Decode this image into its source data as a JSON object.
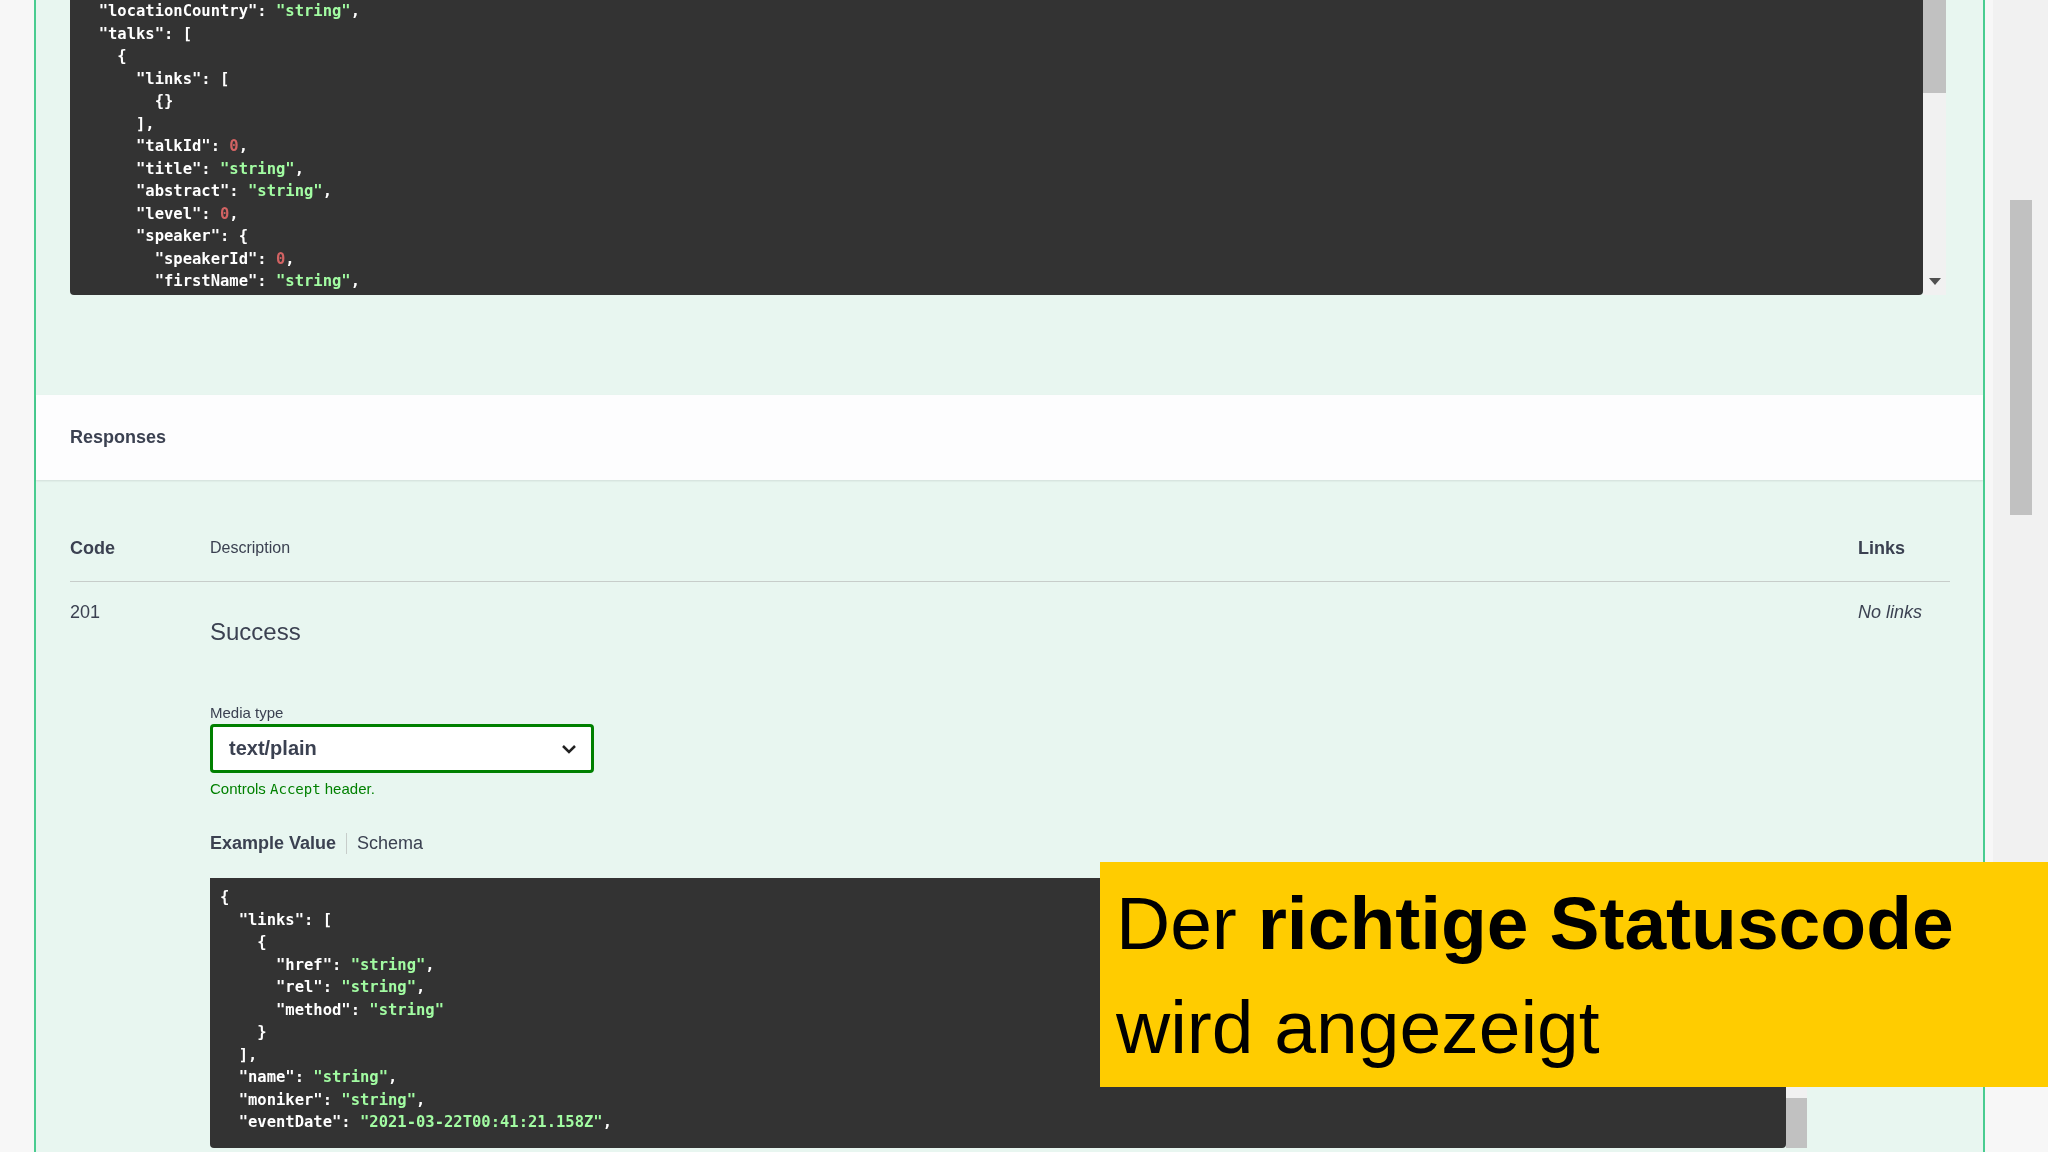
{
  "request_example": {
    "lines": [
      "  \"locationCountry\": \"string\",",
      "  \"talks\": [",
      "    {",
      "      \"links\": [",
      "        {}",
      "      ],",
      "      \"talkId\": 0,",
      "      \"title\": \"string\",",
      "      \"abstract\": \"string\",",
      "      \"level\": 0,",
      "      \"speaker\": {",
      "        \"speakerId\": 0,",
      "        \"firstName\": \"string\","
    ]
  },
  "responses": {
    "title": "Responses",
    "columns": [
      "Code",
      "Description",
      "Links"
    ],
    "rows": [
      {
        "code": "201",
        "description": "Success",
        "links": "No links",
        "media_type": {
          "label": "Media type",
          "value": "text/plain",
          "hint": {
            "before": "Controls",
            "code": "Accept",
            "after": "header."
          }
        },
        "example_tabs": [
          {
            "label": "Example Value",
            "selected": true
          },
          {
            "label": "Schema",
            "selected": false
          }
        ],
        "example_lines": [
          "{",
          "  \"links\": [",
          "    {",
          "      \"href\": \"string\",",
          "      \"rel\": \"string\",",
          "      \"method\": \"string\"",
          "    }",
          "  ],",
          "  \"name\": \"string\",",
          "  \"moniker\": \"string\",",
          "  \"eventDate\": \"2021-03-22T00:41:21.158Z\","
        ]
      }
    ]
  },
  "caption": {
    "lines": [
      "Der **richtige Statuscode**",
      "wird angezeigt"
    ]
  }
}
